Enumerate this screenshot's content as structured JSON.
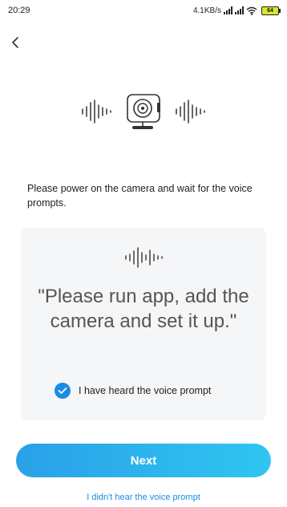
{
  "status_bar": {
    "time": "20:29",
    "net_speed": "4.1KB/s",
    "battery": "64"
  },
  "icons": {
    "back": "chevron-left-icon",
    "camera": "camera-icon",
    "wave": "sound-wave-icon",
    "check": "check-icon"
  },
  "main": {
    "instruction": "Please power on the camera and wait for the voice prompts."
  },
  "prompt_card": {
    "quote": "\"Please run app, add the camera and set it up.\"",
    "confirm_label": "I have heard the voice prompt",
    "confirm_checked": true
  },
  "actions": {
    "next_label": "Next",
    "help_link": "I didn't hear the voice prompt"
  },
  "colors": {
    "accent": "#1a8be3",
    "button_start": "#2aa0e8",
    "button_end": "#2fc6f1",
    "card_bg": "#f5f6f7",
    "battery": "#d8e62c"
  }
}
